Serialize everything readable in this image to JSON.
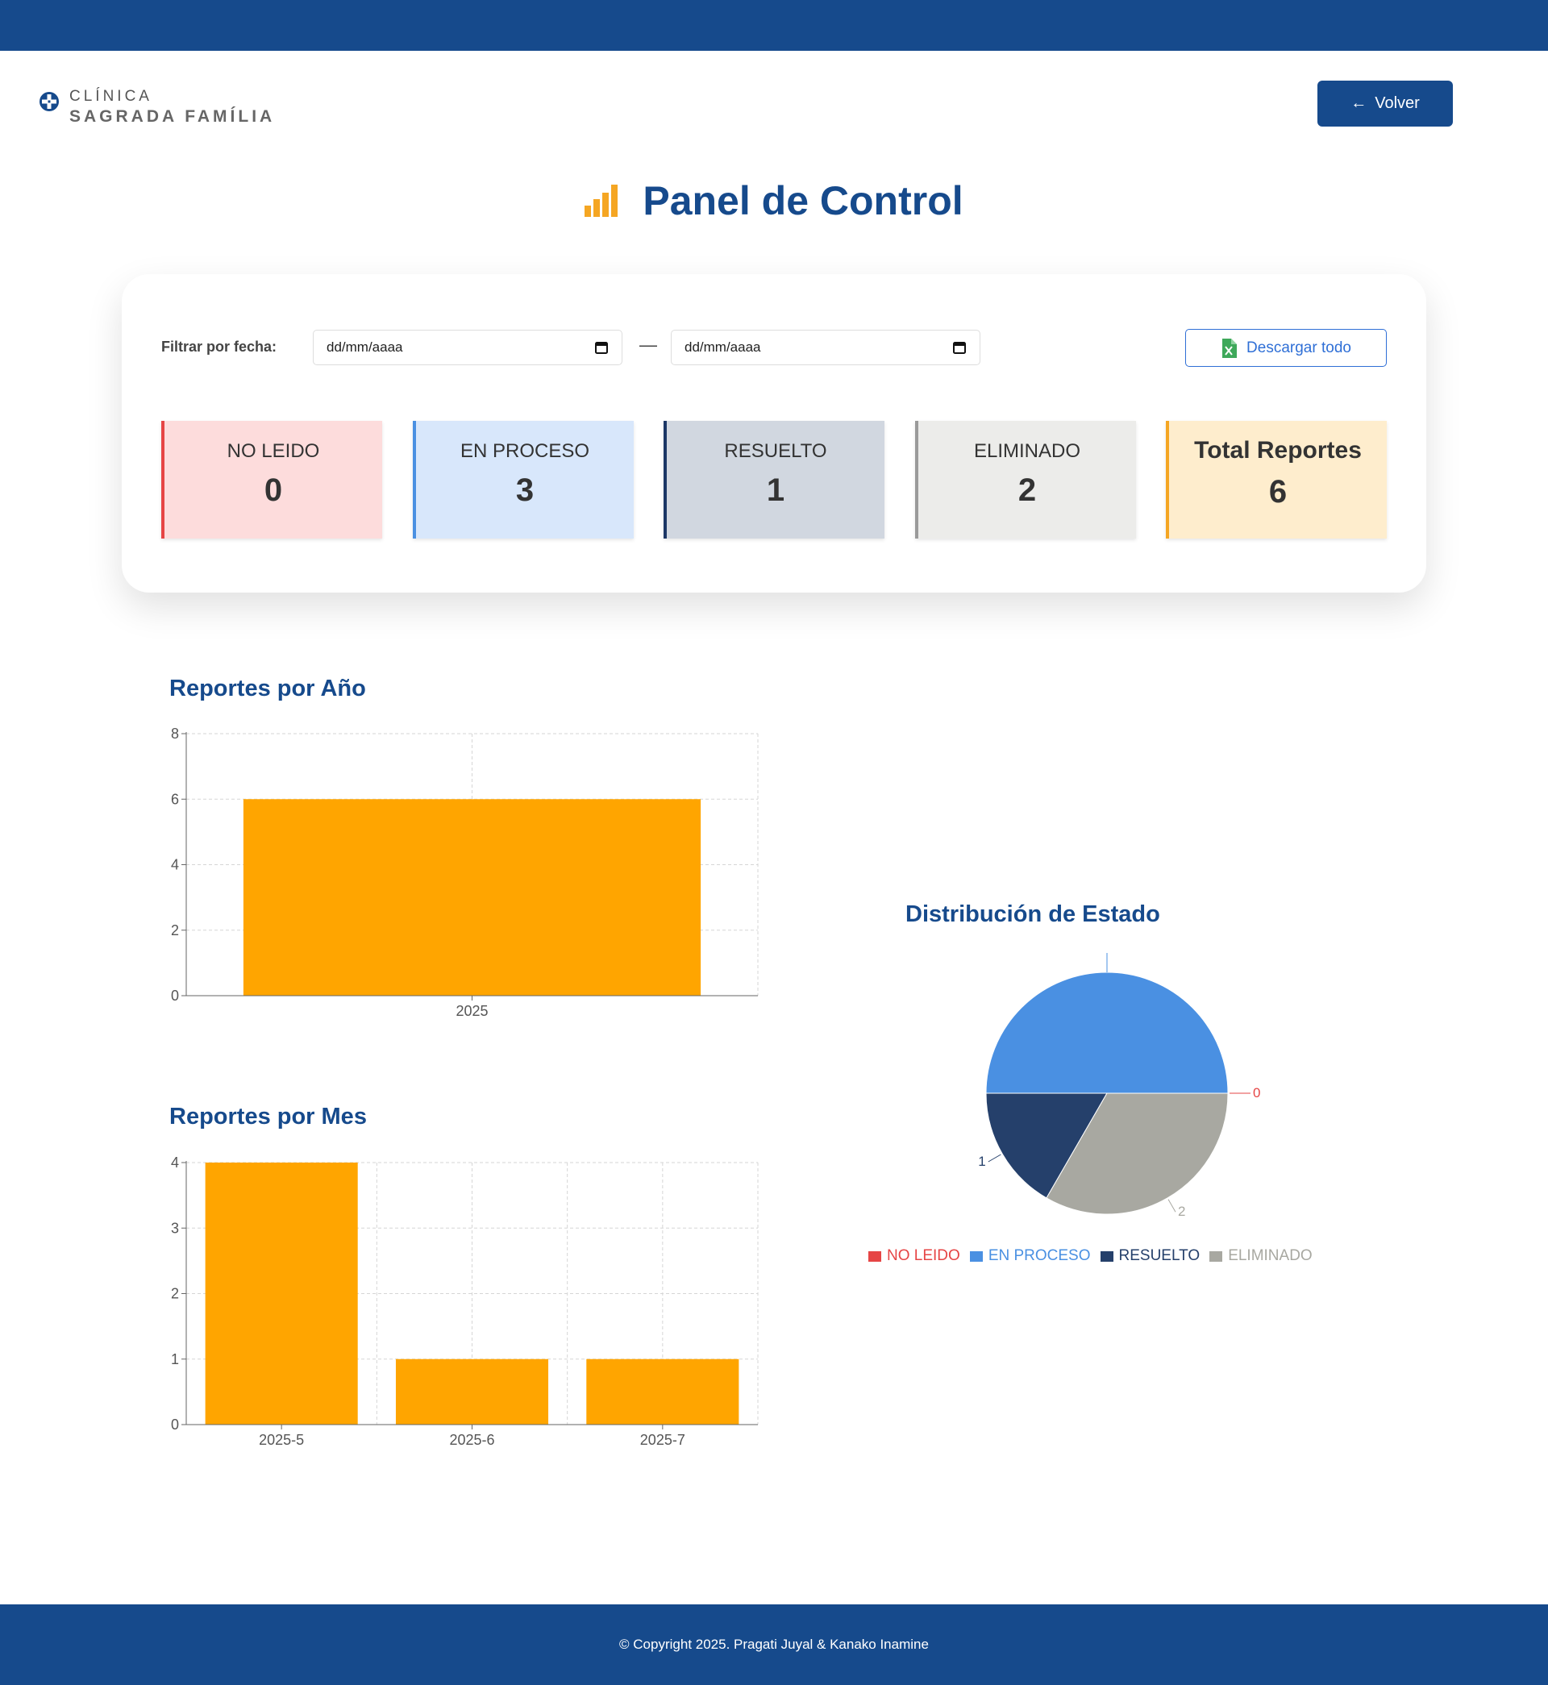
{
  "brand": {
    "line1": "CLÍNICA",
    "line2": "SAGRADA FAMÍLIA",
    "primary_color": "#164a8c"
  },
  "header": {
    "back_label": "Volver",
    "back_icon": "arrow-left-icon"
  },
  "page": {
    "title": "Panel de Control",
    "title_icon": "bar-chart-icon"
  },
  "filter": {
    "label": "Filtrar por fecha:",
    "from_value": "dd/mm/aaaa",
    "to_value": "dd/mm/aaaa",
    "separator": "—",
    "download_label": "Descargar todo",
    "download_icon": "excel-file-icon"
  },
  "stats": [
    {
      "label": "NO LEIDO",
      "value": "0",
      "border": "#e64545",
      "bg": "#fddcdc"
    },
    {
      "label": "EN PROCESO",
      "value": "3",
      "border": "#4a90e2",
      "bg": "#d8e7fb"
    },
    {
      "label": "RESUELTO",
      "value": "1",
      "border": "#1c3766",
      "bg": "#d1d7e0"
    },
    {
      "label": "ELIMINADO",
      "value": "2",
      "border": "#9a9a9a",
      "bg": "#ececea"
    },
    {
      "label": "Total Reportes",
      "value": "6",
      "border": "#f5a623",
      "bg": "#feedcd"
    }
  ],
  "charts": {
    "by_year_title": "Reportes por Año",
    "by_month_title": "Reportes por Mes",
    "status_title": "Distribución de Estado"
  },
  "chart_data": [
    {
      "type": "bar",
      "title": "Reportes por Año",
      "categories": [
        "2025"
      ],
      "values": [
        6
      ],
      "ylim": [
        0,
        8
      ],
      "yticks": [
        0,
        2,
        4,
        6,
        8
      ],
      "grid": true,
      "color": "#ffa500"
    },
    {
      "type": "bar",
      "title": "Reportes por Mes",
      "categories": [
        "2025-5",
        "2025-6",
        "2025-7"
      ],
      "values": [
        4,
        1,
        1
      ],
      "ylim": [
        0,
        4
      ],
      "yticks": [
        0,
        1,
        2,
        3,
        4
      ],
      "grid": true,
      "color": "#ffa500"
    },
    {
      "type": "pie",
      "title": "Distribución de Estado",
      "categories": [
        "NO LEIDO",
        "EN PROCESO",
        "RESUELTO",
        "ELIMINADO"
      ],
      "values": [
        0,
        3,
        1,
        2
      ],
      "colors": [
        "#e64545",
        "#4a90e2",
        "#25406b",
        "#a8a8a1"
      ],
      "legend": "bottom"
    }
  ],
  "footer": {
    "text": "© Copyright 2025. Pragati Juyal & Kanako Inamine"
  }
}
